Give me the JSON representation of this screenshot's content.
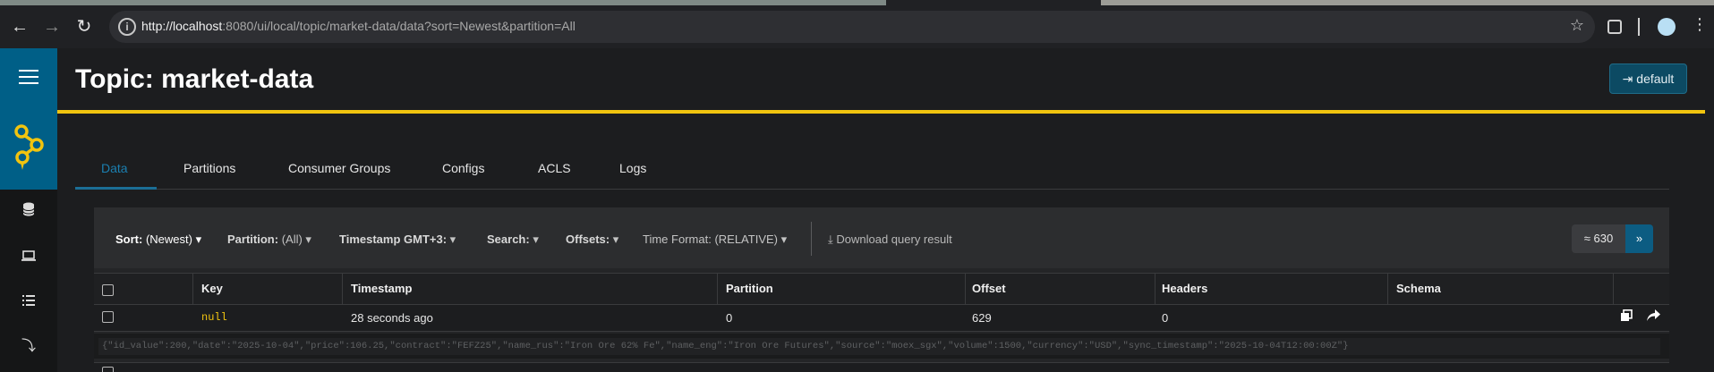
{
  "browser": {
    "url_host": "http://localhost",
    "url_rest": ":8080/ui/local/topic/market-data/data?sort=Newest&partition=All"
  },
  "header": {
    "title": "Topic: market-data",
    "cluster_button": "default"
  },
  "tabs": [
    {
      "label": "Data",
      "active": true
    },
    {
      "label": "Partitions",
      "active": false
    },
    {
      "label": "Consumer Groups",
      "active": false
    },
    {
      "label": "Configs",
      "active": false
    },
    {
      "label": "ACLS",
      "active": false
    },
    {
      "label": "Logs",
      "active": false
    }
  ],
  "filters": {
    "sort_label": "Sort:",
    "sort_value": "(Newest)",
    "partition_label": "Partition:",
    "partition_value": "(All)",
    "timestamp": "Timestamp GMT+3:",
    "search": "Search:",
    "offsets": "Offsets:",
    "time_format_label": "Time Format:",
    "time_format_value": "(RELATIVE)",
    "download": "Download query result"
  },
  "pagination": {
    "count": "≈ 630",
    "next": "»"
  },
  "table": {
    "columns": [
      "Key",
      "Timestamp",
      "Partition",
      "Offset",
      "Headers",
      "Schema"
    ],
    "rows": [
      {
        "key": "null",
        "timestamp": "28 seconds ago",
        "partition": "0",
        "offset": "629",
        "headers": "0",
        "schema": "",
        "value": "{\"id_value\":200,\"date\":\"2025-10-04\",\"price\":106.25,\"contract\":\"FEFZ25\",\"name_rus\":\"Iron Ore 62% Fe\",\"name_eng\":\"Iron Ore Futures\",\"source\":\"moex_sgx\",\"volume\":1500,\"currency\":\"USD\",\"sync_timestamp\":\"2025-10-04T12:00:00Z\"}"
      }
    ]
  },
  "colors": {
    "accent_blue": "#005f87",
    "accent_yellow": "#f1c40f"
  }
}
